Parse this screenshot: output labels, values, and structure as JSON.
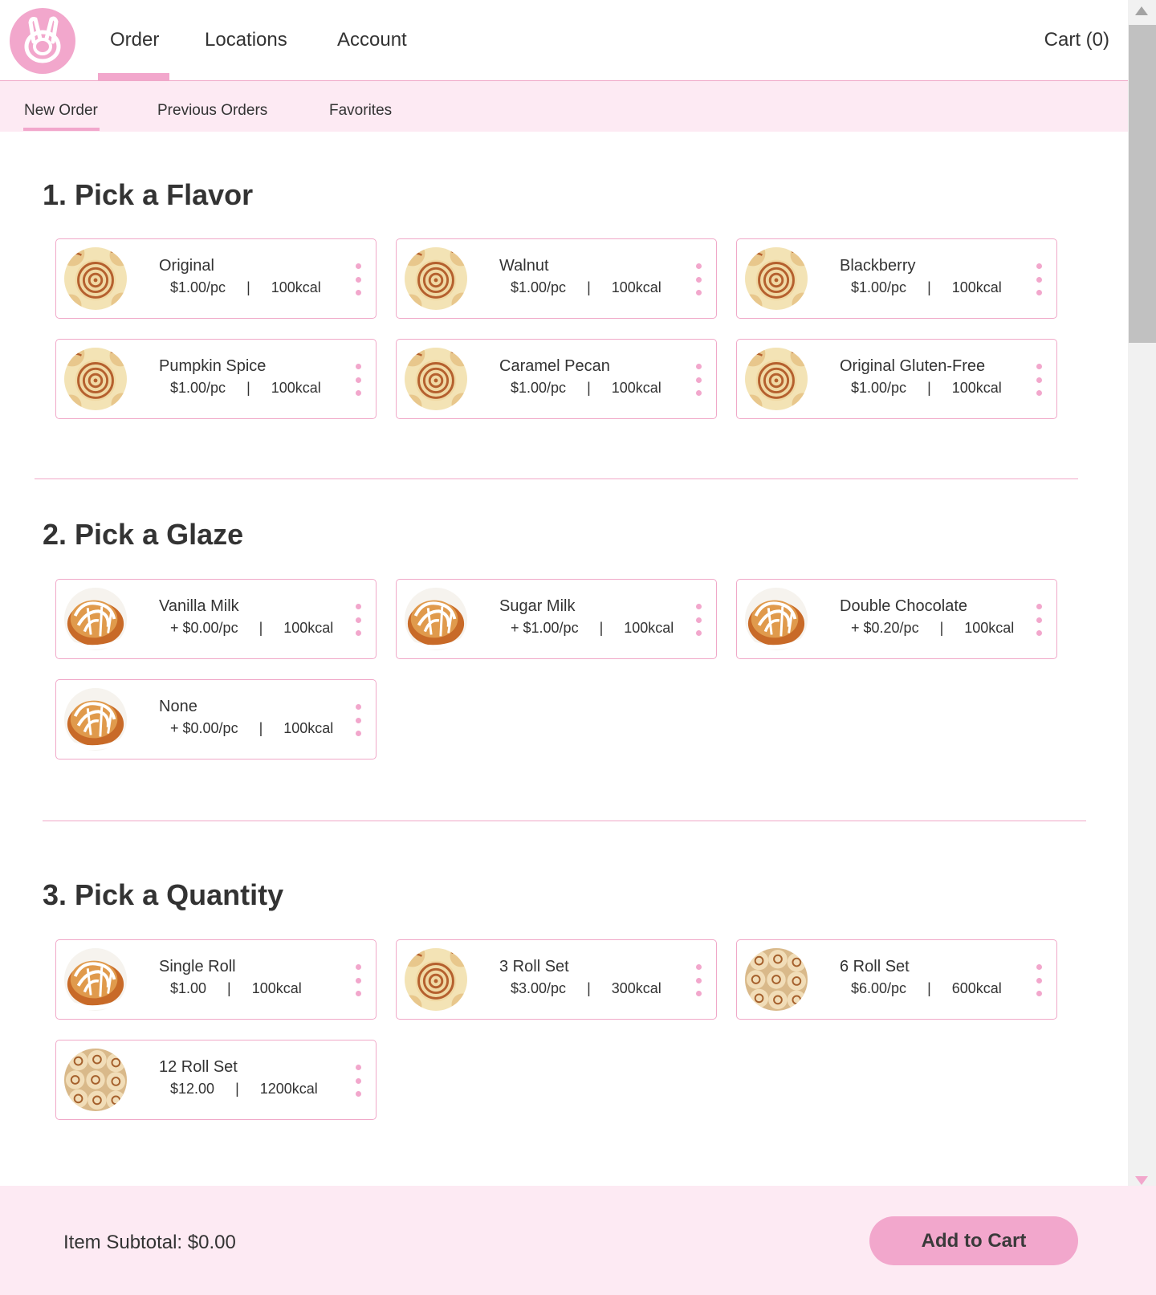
{
  "nav": {
    "links": [
      "Order",
      "Locations",
      "Account"
    ],
    "cart": "Cart (0)",
    "logo_icon": "bunny-logo-icon"
  },
  "subnav": {
    "links": [
      "New Order",
      "Previous Orders",
      "Favorites"
    ]
  },
  "sections": {
    "flavor": {
      "title": "1. Pick a Flavor",
      "items": [
        {
          "name": "Original",
          "price": "$1.00/pc",
          "kcal": "100kcal",
          "image": "cinnamon-roll-top-view"
        },
        {
          "name": "Walnut",
          "price": "$1.00/pc",
          "kcal": "100kcal",
          "image": "cinnamon-roll-top-view"
        },
        {
          "name": "Blackberry",
          "price": "$1.00/pc",
          "kcal": "100kcal",
          "image": "cinnamon-roll-top-view"
        },
        {
          "name": "Pumpkin Spice",
          "price": "$1.00/pc",
          "kcal": "100kcal",
          "image": "cinnamon-roll-top-view"
        },
        {
          "name": "Caramel Pecan",
          "price": "$1.00/pc",
          "kcal": "100kcal",
          "image": "cinnamon-roll-top-view"
        },
        {
          "name": "Original Gluten-Free",
          "price": "$1.00/pc",
          "kcal": "100kcal",
          "image": "cinnamon-roll-top-view"
        }
      ]
    },
    "glaze": {
      "title": "2. Pick a Glaze",
      "items": [
        {
          "name": "Vanilla Milk",
          "price": "+ $0.00/pc",
          "kcal": "100kcal",
          "image": "glazed-roll"
        },
        {
          "name": "Sugar Milk",
          "price": "+ $1.00/pc",
          "kcal": "100kcal",
          "image": "glazed-roll"
        },
        {
          "name": "Double Chocolate",
          "price": "+ $0.20/pc",
          "kcal": "100kcal",
          "image": "glazed-roll"
        },
        {
          "name": "None",
          "price": "+ $0.00/pc",
          "kcal": "100kcal",
          "image": "glazed-roll"
        }
      ]
    },
    "quantity": {
      "title": "3. Pick a Quantity",
      "items": [
        {
          "name": "Single Roll",
          "price": "$1.00",
          "kcal": "100kcal",
          "image": "glazed-roll"
        },
        {
          "name": "3 Roll Set",
          "price": "$3.00/pc",
          "kcal": "300kcal",
          "image": "cinnamon-roll-top-view"
        },
        {
          "name": "6 Roll Set",
          "price": "$6.00/pc",
          "kcal": "600kcal",
          "image": "roll-tray"
        },
        {
          "name": "12 Roll Set",
          "price": "$12.00",
          "kcal": "1200kcal",
          "image": "roll-tray"
        }
      ]
    }
  },
  "footer": {
    "subtotal": "Item Subtotal: $0.00",
    "add_to_cart": "Add to Cart"
  },
  "colors": {
    "accent": "#f2a7cc",
    "accent_light": "#fdeaf3",
    "border": "#f0a8c8",
    "text": "#333333"
  }
}
